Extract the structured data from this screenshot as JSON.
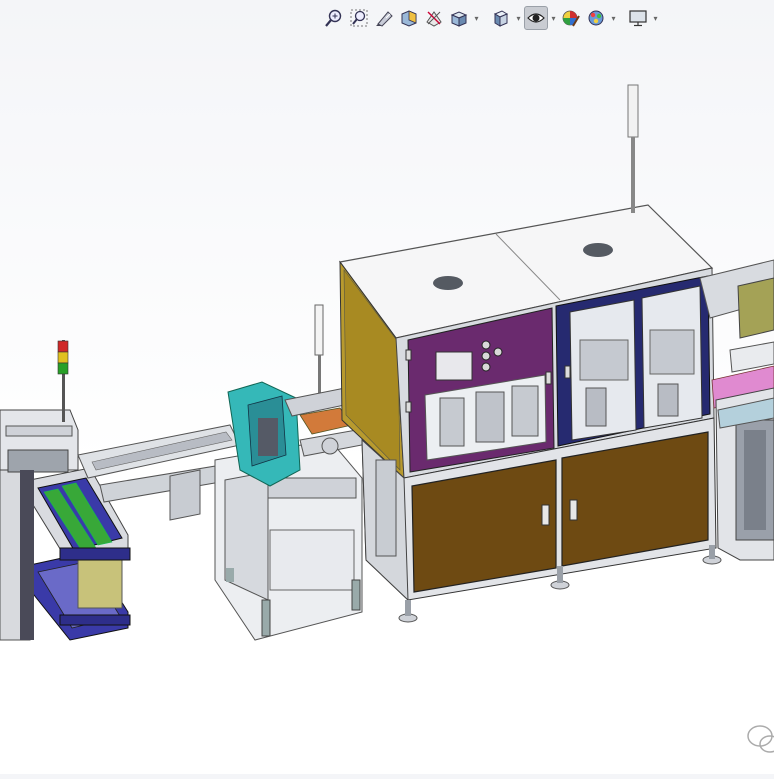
{
  "hud_toolbar": {
    "buttons": [
      {
        "id": "zoom-to-fit",
        "icon": "zoom-to-fit-icon",
        "has_dropdown": false
      },
      {
        "id": "zoom-to-area",
        "icon": "zoom-to-area-icon",
        "has_dropdown": false
      },
      {
        "id": "previous-view",
        "icon": "previous-view-icon",
        "has_dropdown": false
      },
      {
        "id": "section-view",
        "icon": "section-view-icon",
        "has_dropdown": false
      },
      {
        "id": "dynamic-annotation",
        "icon": "dynamic-annotation-icon",
        "has_dropdown": false
      },
      {
        "id": "view-orientation",
        "icon": "view-orientation-icon",
        "has_dropdown": true
      },
      {
        "id": "display-style",
        "icon": "display-style-icon",
        "has_dropdown": true
      },
      {
        "id": "hide-show-items",
        "icon": "hide-show-items-icon",
        "has_dropdown": true,
        "active": true
      },
      {
        "id": "edit-appearance",
        "icon": "edit-appearance-icon",
        "has_dropdown": false
      },
      {
        "id": "apply-scene",
        "icon": "apply-scene-icon",
        "has_dropdown": true
      },
      {
        "id": "view-settings",
        "icon": "view-settings-icon",
        "has_dropdown": true
      }
    ]
  },
  "colors": {
    "background_top": "#f4f5f8",
    "frame_grey": "#c8ccd2",
    "panel_white": "#f2f2f2",
    "yellow_panel": "#b89a2e",
    "purple_panel": "#6a2a6e",
    "navy_panel": "#262a70",
    "brown_cabinet": "#6e4a12",
    "blue_rail": "#3a3aa8",
    "cyan_part": "#35b8b8",
    "orange_part": "#d27a3a",
    "olive_part": "#c8c27a",
    "pink_part": "#e08ad0",
    "green_part": "#38a838",
    "tower_red": "#d02828",
    "tower_yellow": "#e0c020",
    "tower_green": "#28a028"
  },
  "viewport": {
    "model": "automated-assembly-line",
    "watermark_icon": "wechat-icon"
  }
}
